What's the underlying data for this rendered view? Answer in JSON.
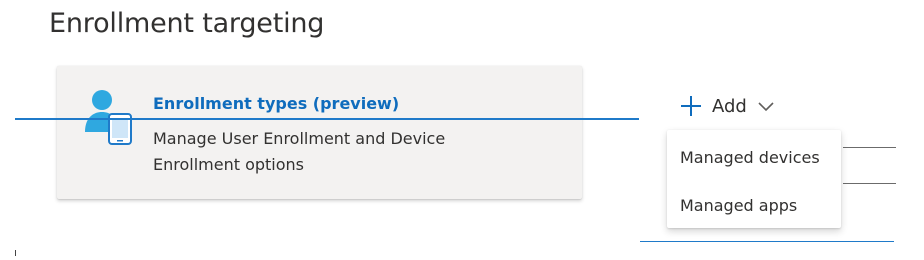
{
  "page": {
    "title": "Enrollment targeting"
  },
  "card": {
    "icon": "user-device-icon",
    "title": "Enrollment types (preview)",
    "description": "Manage User Enrollment and Device Enrollment options"
  },
  "toolbar": {
    "add_icon": "plus-icon",
    "add_label": "Add",
    "add_chevron": "chevron-down-icon"
  },
  "dropdown": {
    "items": [
      {
        "label": "Managed devices"
      },
      {
        "label": "Managed apps"
      }
    ]
  },
  "colors": {
    "link": "#0f6cbd",
    "accent_line": "#1f7ac9",
    "card_bg": "#f3f2f1",
    "text": "#323130"
  }
}
